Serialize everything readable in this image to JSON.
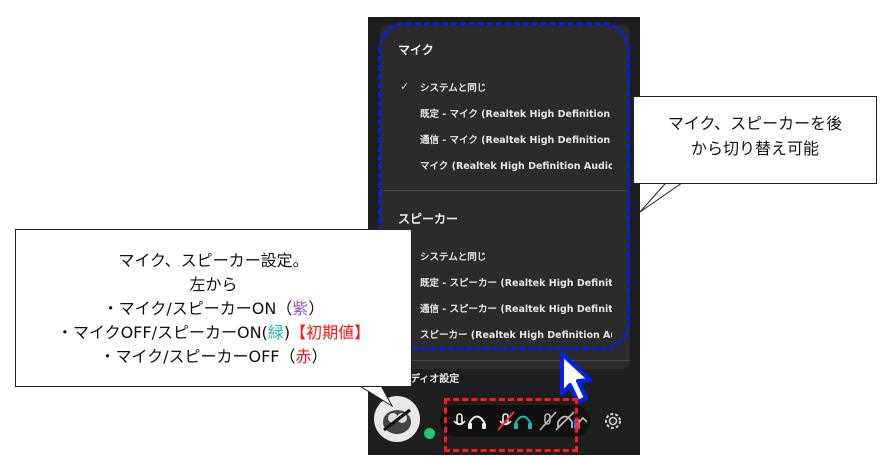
{
  "menu": {
    "mic_title": "マイク",
    "mic_items": [
      "システムと同じ",
      "既定 - マイク (Realtek High Definition ...",
      "通信 - マイク (Realtek High Definition ...",
      "マイク (Realtek High Definition Audio)"
    ],
    "speaker_title": "スピーカー",
    "speaker_items": [
      "システムと同じ",
      "既定 - スピーカー (Realtek High Definiti...",
      "通信 - スピーカー (Realtek High Definiti...",
      "スピーカー (Realtek High Definition Au..."
    ],
    "footer_label": "ディオ設定"
  },
  "callouts": {
    "right": {
      "line1": "マイク、スピーカーを後",
      "line2": "から切り替え可能"
    },
    "left": {
      "line1": "マイク、スピーカー設定。",
      "line2": "左から",
      "line3_prefix": "・マイク/スピーカーON（",
      "line3_color": "紫",
      "line3_suffix": "）",
      "line4_prefix": "・マイクOFF/スピーカーON(",
      "line4_color": "緑",
      "line4_suffix": ")",
      "line4_badge": "【初期値】",
      "line5_prefix": "・マイク/スピーカーOFF（",
      "line5_color": "赤",
      "line5_suffix": "）"
    }
  },
  "controls": {
    "icons": [
      "mic-headphone-icon",
      "mic-off-headphone-icon",
      "mic-off-headphone-off-icon",
      "chevron-up-icon",
      "gear-icon"
    ]
  },
  "colors": {
    "panel_bg": "#1e1e1e",
    "menu_bg": "#2b2b2b",
    "highlight_blue": "#0022ee",
    "highlight_red": "#ff1a1a",
    "status_green": "#22c46a",
    "purple": "#9b59d0",
    "teal": "#1fb6b6",
    "red": "#ff1111"
  }
}
